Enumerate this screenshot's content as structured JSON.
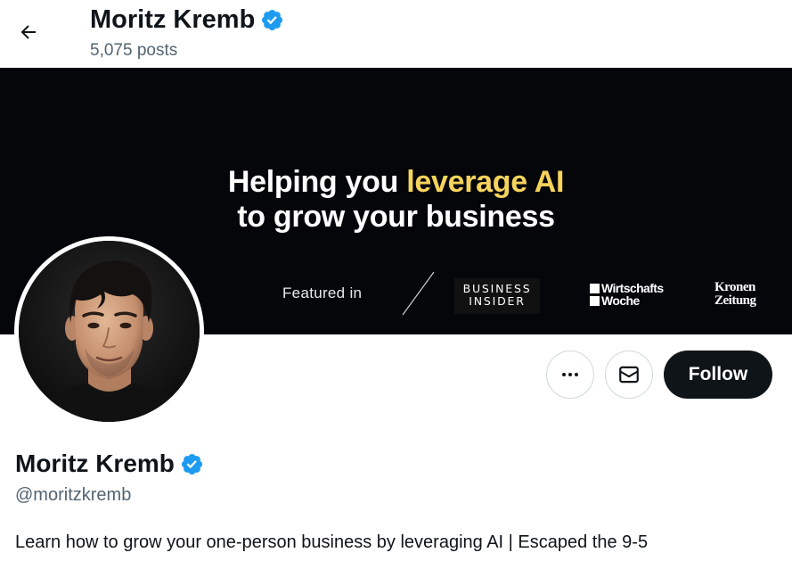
{
  "header": {
    "name": "Moritz Kremb",
    "posts": "5,075 posts",
    "back_icon": "arrow-left-icon"
  },
  "banner": {
    "headline_part1": "Helping you ",
    "headline_accent": "leverage AI",
    "headline_line2": "to grow your business",
    "featured_label": "Featured in",
    "logos": {
      "business_insider_line1": "BUSINESS",
      "business_insider_line2": "INSIDER",
      "wirtschaftswoche_line1": "Wirtschafts",
      "wirtschaftswoche_line2": "Woche",
      "kronen_line1": "Kronen",
      "kronen_line2": "Zeitung"
    },
    "colors": {
      "background": "#05060a",
      "accent": "#f6d35c"
    }
  },
  "actions": {
    "more_icon": "ellipsis-icon",
    "message_icon": "envelope-icon",
    "follow_label": "Follow"
  },
  "profile": {
    "name": "Moritz Kremb",
    "handle": "@moritzkremb",
    "bio": "Learn how to grow your one-person business by leveraging AI | Escaped the 9-5",
    "verified_icon": "verified-badge-icon"
  },
  "colors": {
    "verified_blue": "#1d9bf0",
    "text_primary": "#0f1419",
    "text_secondary": "#536471",
    "follow_bg": "#0f1419"
  }
}
